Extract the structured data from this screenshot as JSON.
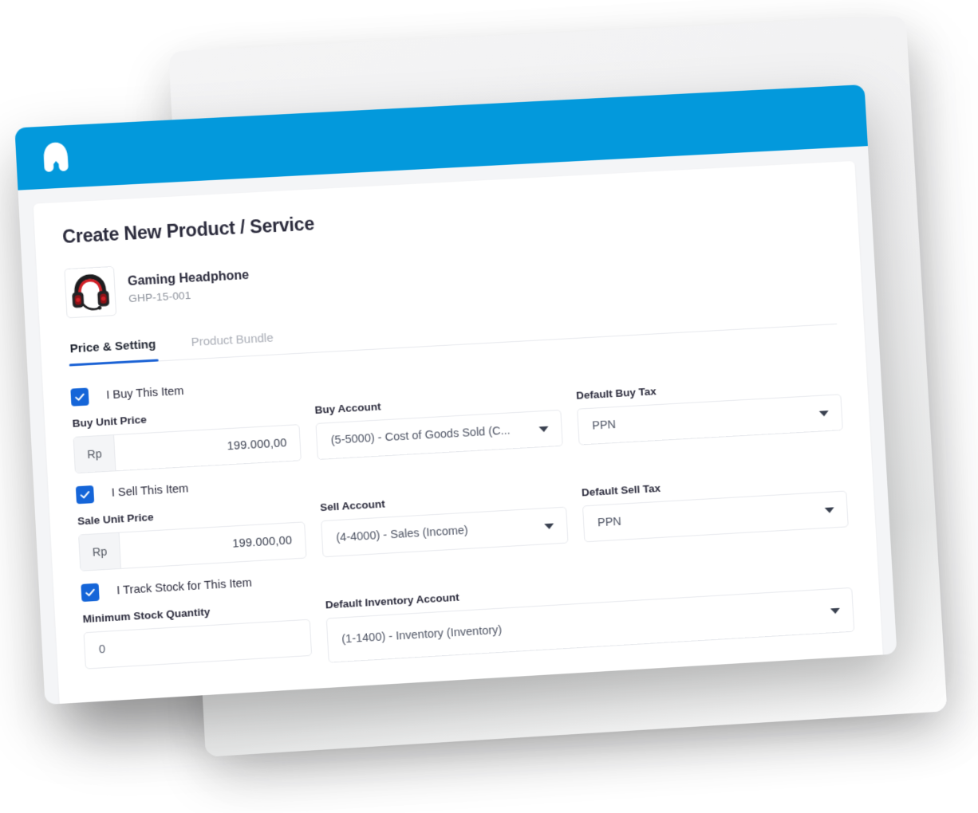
{
  "brand": {
    "logo_icon": "accurate-arch-logo",
    "header_color": "#0399DC"
  },
  "page": {
    "title": "Create New Product / Service"
  },
  "product": {
    "thumbnail_icon": "gaming-headset-image",
    "name": "Gaming Headphone",
    "code": "GHP-15-001"
  },
  "tabs": [
    {
      "label": "Price & Setting",
      "active": true
    },
    {
      "label": "Product Bundle",
      "active": false
    }
  ],
  "accent": {
    "tab_underline": "#1C63D5",
    "checkbox": "#1565D8"
  },
  "buy_section": {
    "checkbox_label": "I Buy This Item",
    "checked": true,
    "unit_price": {
      "label": "Buy Unit Price",
      "currency_prefix": "Rp",
      "value": "199.000,00"
    },
    "account": {
      "label": "Buy Account",
      "value": "(5-5000) - Cost of Goods Sold (C..."
    },
    "tax": {
      "label": "Default Buy Tax",
      "value": "PPN"
    }
  },
  "sell_section": {
    "checkbox_label": "I Sell This Item",
    "checked": true,
    "unit_price": {
      "label": "Sale Unit Price",
      "currency_prefix": "Rp",
      "value": "199.000,00"
    },
    "account": {
      "label": "Sell Account",
      "value": "(4-4000) - Sales (Income)"
    },
    "tax": {
      "label": "Default Sell Tax",
      "value": "PPN"
    }
  },
  "stock_section": {
    "checkbox_label": "I Track Stock for This Item",
    "checked": true,
    "min_quantity": {
      "label": "Minimum Stock Quantity",
      "value": "0"
    },
    "inventory_account": {
      "label": "Default Inventory Account",
      "value": "(1-1400) - Inventory (Inventory)"
    }
  }
}
